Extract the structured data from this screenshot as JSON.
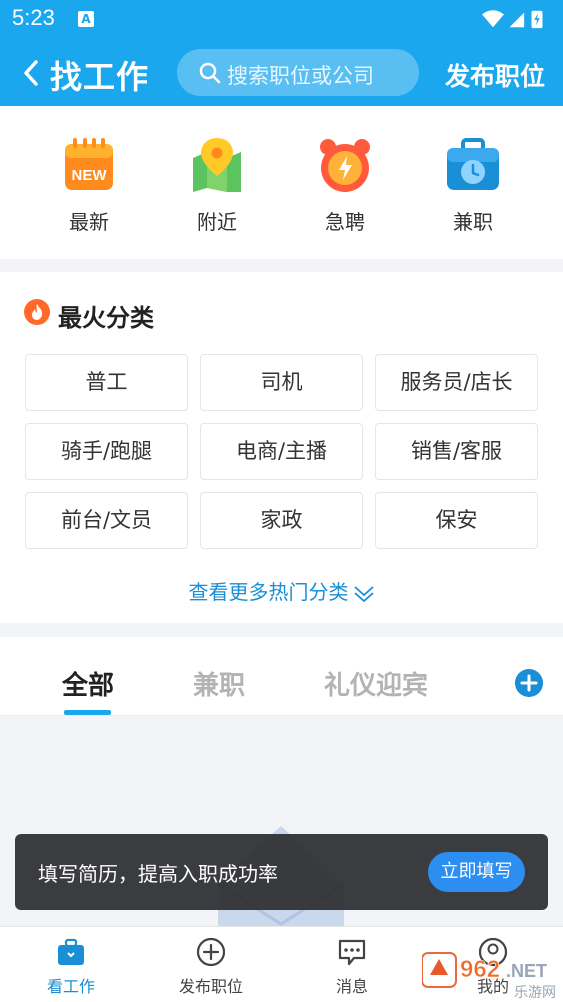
{
  "status_bar": {
    "time": "5:23",
    "notification_letter": "A"
  },
  "nav": {
    "title": "找工作",
    "search_placeholder": "搜索职位或公司",
    "publish_label": "发布职位"
  },
  "quick_entries": [
    {
      "label": "最新",
      "icon": "new-badge-icon"
    },
    {
      "label": "附近",
      "icon": "map-pin-icon"
    },
    {
      "label": "急聘",
      "icon": "alarm-clock-icon"
    },
    {
      "label": "兼职",
      "icon": "briefcase-clock-icon"
    }
  ],
  "hot_categories": {
    "title": "最火分类",
    "items": [
      "普工",
      "司机",
      "服务员/店长",
      "骑手/跑腿",
      "电商/主播",
      "销售/客服",
      "前台/文员",
      "家政",
      "保安"
    ],
    "more_label": "查看更多热门分类"
  },
  "tabs": {
    "items": [
      "全部",
      "兼职",
      "礼仪迎宾"
    ],
    "active_index": 0
  },
  "toast": {
    "text": "填写简历，提高入职成功率",
    "button_label": "立即填写"
  },
  "tab_bar": {
    "items": [
      {
        "label": "看工作",
        "icon": "briefcase-icon",
        "active": true
      },
      {
        "label": "发布职位",
        "icon": "plus-circle-icon",
        "active": false
      },
      {
        "label": "消息",
        "icon": "chat-bubble-icon",
        "active": false
      },
      {
        "label": "我的",
        "icon": "user-icon",
        "active": false
      }
    ]
  },
  "watermark": {
    "brand_digits": "962",
    "brand_suffix": ".NET",
    "site_name": "乐游网"
  },
  "colors": {
    "primary": "#1aa7ee",
    "link": "#1a8fd6",
    "fire": "#ff6a2b"
  }
}
